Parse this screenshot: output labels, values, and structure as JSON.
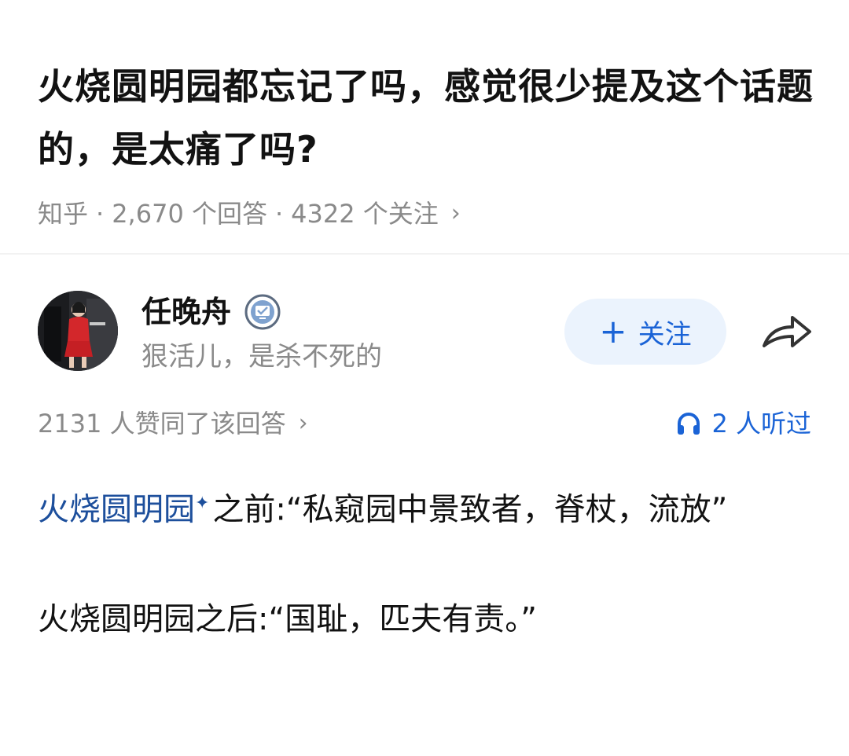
{
  "question": {
    "title": "火烧圆明园都忘记了吗，感觉很少提及这个话题的，是太痛了吗?",
    "source": "知乎",
    "answers": "2,670 个回答",
    "followers": "4322 个关注",
    "separator": "·",
    "chevron": "›"
  },
  "author": {
    "name": "任晚舟",
    "bio": "狠活儿，是杀不死的",
    "avatar_icon": "avatar-photo",
    "badge_icon": "verified-badge-icon"
  },
  "actions": {
    "follow_plus": "+",
    "follow_label": "关注",
    "share_icon": "share-arrow-icon",
    "accent_color": "#1a63d6"
  },
  "stats": {
    "likes": "2131 人赞同了该回答",
    "chevron": "›",
    "listened": "2 人听过",
    "listened_icon": "headphones-icon"
  },
  "answer": {
    "topic_link": "火烧圆明园",
    "topic_sparkle": "✦",
    "para1_rest": "之前:“私窥园中景致者，脊杖，流放”",
    "para2": "火烧圆明园之后:“国耻，匹夫有责。”"
  }
}
